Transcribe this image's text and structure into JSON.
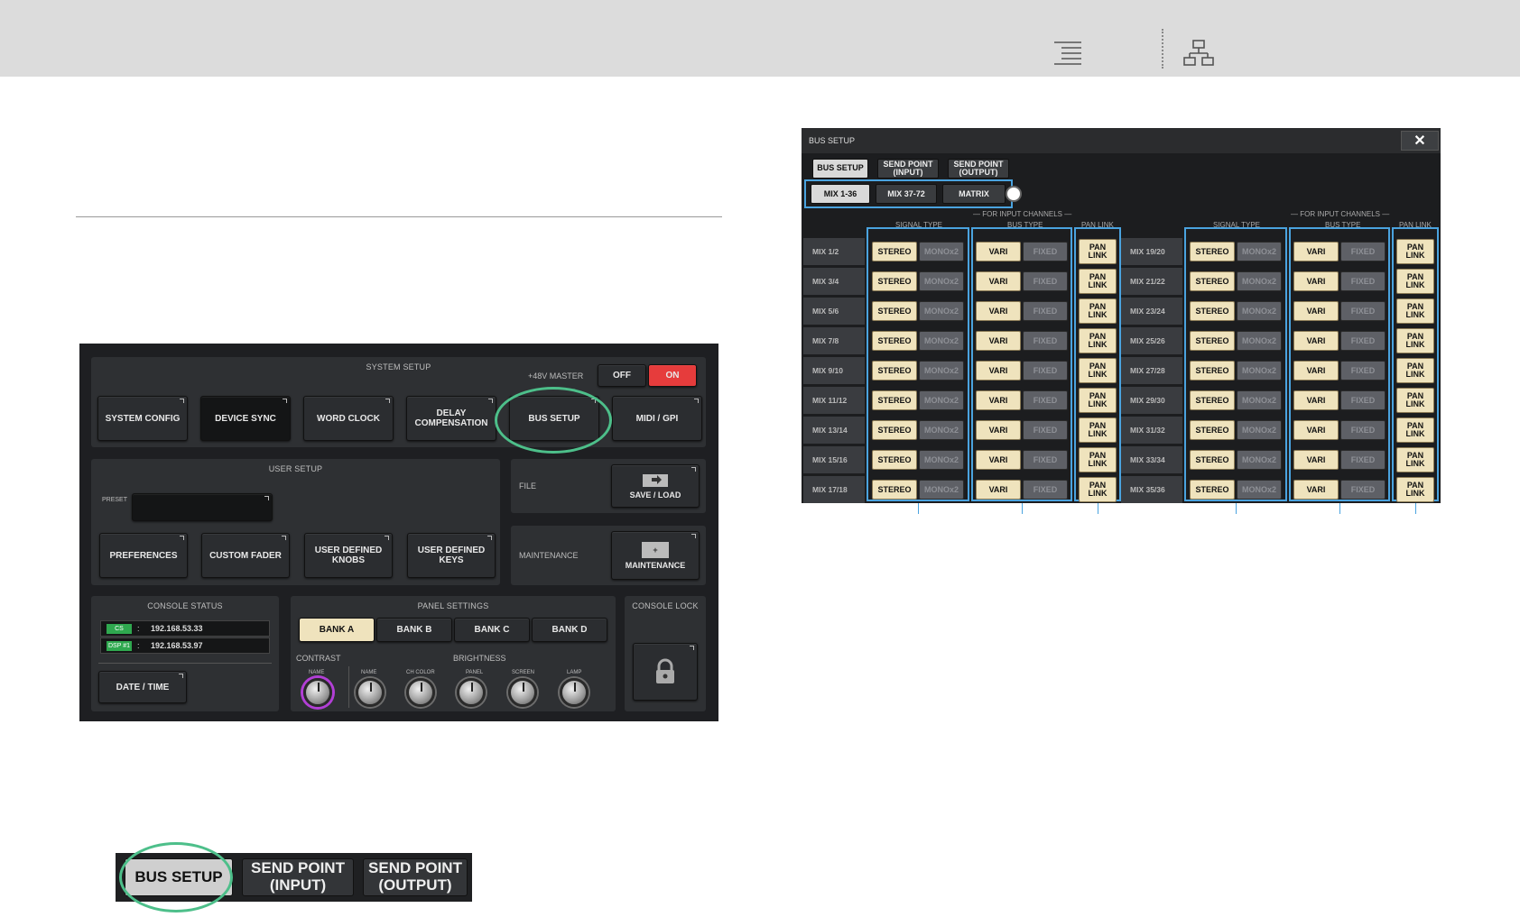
{
  "toolbar": {
    "toc_icon": "toc-lines-icon",
    "tree_icon": "sitemap-icon"
  },
  "setup": {
    "system_title": "SYSTEM SETUP",
    "master_label": "+48V MASTER",
    "off": "OFF",
    "on": "ON",
    "buttons": [
      "SYSTEM CONFIG",
      "DEVICE SYNC",
      "WORD CLOCK",
      "DELAY\nCOMPENSATION",
      "BUS SETUP",
      "MIDI / GPI"
    ],
    "user_title": "USER SETUP",
    "preset_label": "PRESET",
    "user_buttons": [
      "PREFERENCES",
      "CUSTOM FADER",
      "USER DEFINED\nKNOBS",
      "USER DEFINED\nKEYS"
    ],
    "file_label": "FILE",
    "save_load": "SAVE / LOAD",
    "maint_label": "MAINTENANCE",
    "maint_button": "MAINTENANCE",
    "console_status_title": "CONSOLE STATUS",
    "cs_badge": "CS",
    "cs_ip": "192.168.53.33",
    "dsp_badge": "DSP #1",
    "dsp_ip": "192.168.53.97",
    "colon": ":",
    "date_time": "DATE / TIME",
    "panel_title": "PANEL SETTINGS",
    "banks": [
      "BANK A",
      "BANK B",
      "BANK C",
      "BANK D"
    ],
    "contrast": "CONTRAST",
    "brightness": "BRIGHTNESS",
    "knob_labels": [
      "NAME",
      "NAME",
      "CH COLOR",
      "PANEL",
      "SCREEN",
      "LAMP"
    ],
    "lock_title": "CONSOLE LOCK"
  },
  "bus_setup": {
    "title": "BUS SETUP",
    "close": "✕",
    "tabs": [
      "BUS SETUP",
      "SEND POINT\n(INPUT)",
      "SEND POINT\n(OUTPUT)"
    ],
    "subtabs": [
      "MIX 1-36",
      "MIX 37-72",
      "MATRIX"
    ],
    "for_input": "FOR INPUT CHANNELS",
    "signal_type": "SIGNAL TYPE",
    "bus_type": "BUS TYPE",
    "pan_link_hdr": "PAN LINK",
    "stereo": "STEREO",
    "mono": "MONOx2",
    "vari": "VARI",
    "fixed": "FIXED",
    "pan_link": "PAN\nLINK",
    "left_rows": [
      "MIX 1/2",
      "MIX 3/4",
      "MIX 5/6",
      "MIX 7/8",
      "MIX 9/10",
      "MIX 11/12",
      "MIX 13/14",
      "MIX 15/16",
      "MIX 17/18"
    ],
    "right_rows": [
      "MIX 19/20",
      "MIX 21/22",
      "MIX 23/24",
      "MIX 25/26",
      "MIX 27/28",
      "MIX 29/30",
      "MIX 31/32",
      "MIX 33/34",
      "MIX 35/36"
    ]
  },
  "bottom_tabs": [
    "BUS SETUP",
    "SEND POINT\n(INPUT)",
    "SEND POINT\n(OUTPUT)"
  ]
}
